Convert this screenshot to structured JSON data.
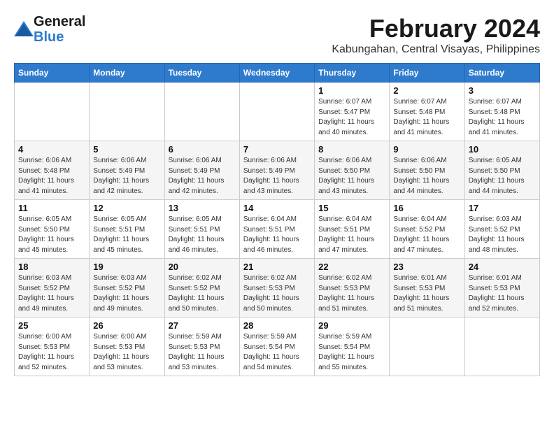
{
  "logo": {
    "line1": "General",
    "line2": "Blue"
  },
  "title": "February 2024",
  "subtitle": "Kabungahan, Central Visayas, Philippines",
  "headers": [
    "Sunday",
    "Monday",
    "Tuesday",
    "Wednesday",
    "Thursday",
    "Friday",
    "Saturday"
  ],
  "weeks": [
    [
      {
        "day": "",
        "info": ""
      },
      {
        "day": "",
        "info": ""
      },
      {
        "day": "",
        "info": ""
      },
      {
        "day": "",
        "info": ""
      },
      {
        "day": "1",
        "info": "Sunrise: 6:07 AM\nSunset: 5:47 PM\nDaylight: 11 hours\nand 40 minutes."
      },
      {
        "day": "2",
        "info": "Sunrise: 6:07 AM\nSunset: 5:48 PM\nDaylight: 11 hours\nand 41 minutes."
      },
      {
        "day": "3",
        "info": "Sunrise: 6:07 AM\nSunset: 5:48 PM\nDaylight: 11 hours\nand 41 minutes."
      }
    ],
    [
      {
        "day": "4",
        "info": "Sunrise: 6:06 AM\nSunset: 5:48 PM\nDaylight: 11 hours\nand 41 minutes."
      },
      {
        "day": "5",
        "info": "Sunrise: 6:06 AM\nSunset: 5:49 PM\nDaylight: 11 hours\nand 42 minutes."
      },
      {
        "day": "6",
        "info": "Sunrise: 6:06 AM\nSunset: 5:49 PM\nDaylight: 11 hours\nand 42 minutes."
      },
      {
        "day": "7",
        "info": "Sunrise: 6:06 AM\nSunset: 5:49 PM\nDaylight: 11 hours\nand 43 minutes."
      },
      {
        "day": "8",
        "info": "Sunrise: 6:06 AM\nSunset: 5:50 PM\nDaylight: 11 hours\nand 43 minutes."
      },
      {
        "day": "9",
        "info": "Sunrise: 6:06 AM\nSunset: 5:50 PM\nDaylight: 11 hours\nand 44 minutes."
      },
      {
        "day": "10",
        "info": "Sunrise: 6:05 AM\nSunset: 5:50 PM\nDaylight: 11 hours\nand 44 minutes."
      }
    ],
    [
      {
        "day": "11",
        "info": "Sunrise: 6:05 AM\nSunset: 5:50 PM\nDaylight: 11 hours\nand 45 minutes."
      },
      {
        "day": "12",
        "info": "Sunrise: 6:05 AM\nSunset: 5:51 PM\nDaylight: 11 hours\nand 45 minutes."
      },
      {
        "day": "13",
        "info": "Sunrise: 6:05 AM\nSunset: 5:51 PM\nDaylight: 11 hours\nand 46 minutes."
      },
      {
        "day": "14",
        "info": "Sunrise: 6:04 AM\nSunset: 5:51 PM\nDaylight: 11 hours\nand 46 minutes."
      },
      {
        "day": "15",
        "info": "Sunrise: 6:04 AM\nSunset: 5:51 PM\nDaylight: 11 hours\nand 47 minutes."
      },
      {
        "day": "16",
        "info": "Sunrise: 6:04 AM\nSunset: 5:52 PM\nDaylight: 11 hours\nand 47 minutes."
      },
      {
        "day": "17",
        "info": "Sunrise: 6:03 AM\nSunset: 5:52 PM\nDaylight: 11 hours\nand 48 minutes."
      }
    ],
    [
      {
        "day": "18",
        "info": "Sunrise: 6:03 AM\nSunset: 5:52 PM\nDaylight: 11 hours\nand 49 minutes."
      },
      {
        "day": "19",
        "info": "Sunrise: 6:03 AM\nSunset: 5:52 PM\nDaylight: 11 hours\nand 49 minutes."
      },
      {
        "day": "20",
        "info": "Sunrise: 6:02 AM\nSunset: 5:52 PM\nDaylight: 11 hours\nand 50 minutes."
      },
      {
        "day": "21",
        "info": "Sunrise: 6:02 AM\nSunset: 5:53 PM\nDaylight: 11 hours\nand 50 minutes."
      },
      {
        "day": "22",
        "info": "Sunrise: 6:02 AM\nSunset: 5:53 PM\nDaylight: 11 hours\nand 51 minutes."
      },
      {
        "day": "23",
        "info": "Sunrise: 6:01 AM\nSunset: 5:53 PM\nDaylight: 11 hours\nand 51 minutes."
      },
      {
        "day": "24",
        "info": "Sunrise: 6:01 AM\nSunset: 5:53 PM\nDaylight: 11 hours\nand 52 minutes."
      }
    ],
    [
      {
        "day": "25",
        "info": "Sunrise: 6:00 AM\nSunset: 5:53 PM\nDaylight: 11 hours\nand 52 minutes."
      },
      {
        "day": "26",
        "info": "Sunrise: 6:00 AM\nSunset: 5:53 PM\nDaylight: 11 hours\nand 53 minutes."
      },
      {
        "day": "27",
        "info": "Sunrise: 5:59 AM\nSunset: 5:53 PM\nDaylight: 11 hours\nand 53 minutes."
      },
      {
        "day": "28",
        "info": "Sunrise: 5:59 AM\nSunset: 5:54 PM\nDaylight: 11 hours\nand 54 minutes."
      },
      {
        "day": "29",
        "info": "Sunrise: 5:59 AM\nSunset: 5:54 PM\nDaylight: 11 hours\nand 55 minutes."
      },
      {
        "day": "",
        "info": ""
      },
      {
        "day": "",
        "info": ""
      }
    ]
  ]
}
